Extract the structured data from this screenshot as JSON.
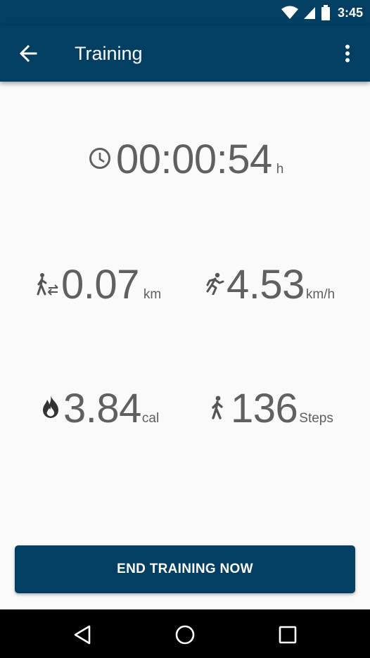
{
  "status_bar": {
    "time": "3:45"
  },
  "app_bar": {
    "title": "Training"
  },
  "timer": {
    "value": "00:00:54",
    "unit": "h"
  },
  "distance": {
    "value": "0.07",
    "unit": "km"
  },
  "speed": {
    "value": "4.53",
    "unit": "km/h"
  },
  "calories": {
    "value": "3.84",
    "unit": "cal"
  },
  "steps": {
    "value": "136",
    "unit": "Steps"
  },
  "actions": {
    "end_label": "END TRAINING NOW"
  },
  "colors": {
    "primary": "#033e63",
    "text": "#606060",
    "background": "#fafafa"
  },
  "icons": {
    "back": "arrow-left-icon",
    "menu": "more-vert-icon",
    "timer": "clock-icon",
    "distance": "walk-distance-icon",
    "speed": "run-icon",
    "calories": "flame-icon",
    "steps": "walk-icon"
  }
}
